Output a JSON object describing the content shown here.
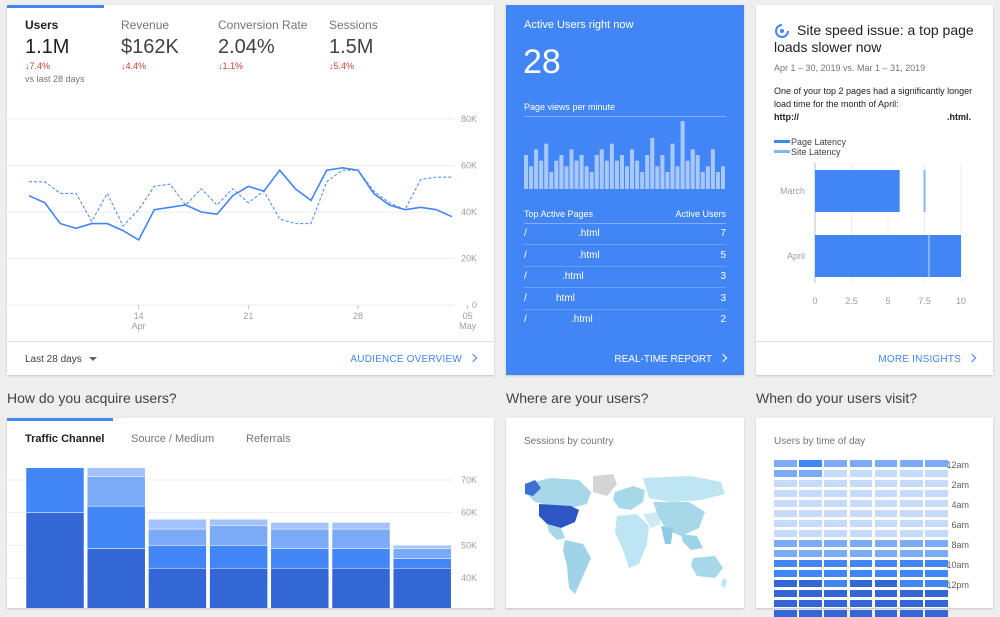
{
  "overview": {
    "tabs": [
      {
        "label": "Users",
        "value": "1.1M",
        "change": "↓7.4%",
        "active": true
      },
      {
        "label": "Revenue",
        "value": "$162K",
        "change": "↓4.4%",
        "active": false
      },
      {
        "label": "Conversion Rate",
        "value": "2.04%",
        "change": "↓1.1%",
        "active": false
      },
      {
        "label": "Sessions",
        "value": "1.5M",
        "change": "↓5.4%",
        "active": false
      }
    ],
    "compare_text": "vs last 28 days",
    "date_range": "Last 28 days",
    "footer_link": "AUDIENCE OVERVIEW"
  },
  "chart_data": {
    "type": "line",
    "y_ticks": [
      "80K",
      "60K",
      "40K",
      "20K",
      "0"
    ],
    "ylim": [
      0,
      80000
    ],
    "x_tick_labels": [
      {
        "day": "14",
        "month": "Apr",
        "index": 7
      },
      {
        "day": "21",
        "month": "",
        "index": 14
      },
      {
        "day": "28",
        "month": "",
        "index": 21
      },
      {
        "day": "05",
        "month": "May",
        "index": 28
      }
    ],
    "grid": true,
    "series": [
      {
        "values": [
          47000,
          44000,
          35000,
          33000,
          35000,
          35000,
          32000,
          28000,
          41000,
          42000,
          43000,
          40000,
          39000,
          47000,
          51000,
          49000,
          58000,
          50000,
          45000,
          58000,
          59000,
          58000,
          48000,
          43000,
          41000,
          42000,
          41000,
          38000
        ],
        "color": "#4285f4",
        "dashed": false
      },
      {
        "values": [
          53000,
          53000,
          48000,
          48000,
          36000,
          48000,
          34000,
          41000,
          51000,
          52000,
          43000,
          50000,
          43000,
          50000,
          44000,
          49000,
          37000,
          35000,
          35000,
          53000,
          58000,
          58000,
          49000,
          44000,
          41000,
          54000,
          55000,
          55000
        ],
        "color": "#4285f4",
        "dashed": true
      }
    ]
  },
  "realtime": {
    "title": "Active Users right now",
    "count": "28",
    "pageviews_label": "Page views per minute",
    "bars": [
      6,
      4,
      7,
      5,
      8,
      3,
      5,
      6,
      4,
      7,
      5,
      6,
      4,
      3,
      6,
      7,
      5,
      8,
      5,
      6,
      4,
      7,
      5,
      3,
      6,
      9,
      4,
      6,
      3,
      8,
      4,
      12,
      5,
      7,
      6,
      3,
      4,
      7,
      3,
      4
    ],
    "table_header_left": "Top Active Pages",
    "table_header_right": "Active Users",
    "rows": [
      {
        "page": "/",
        "ext": ".html",
        "users": "7"
      },
      {
        "page": "/",
        "ext": ".html",
        "users": "5"
      },
      {
        "page": "/",
        "ext": ".html",
        "users": "3"
      },
      {
        "page": "/",
        "ext": "html",
        "users": "3"
      },
      {
        "page": "/",
        "ext": ".html",
        "users": "2"
      }
    ],
    "footer_link": "REAL-TIME REPORT"
  },
  "insight": {
    "title": "Site speed issue: a top page loads slower now",
    "date_range": "Apr 1 – 30, 2019 vs. Mar 1 – 31, 2019",
    "body": "One of your top 2 pages had a significantly longer load time for the month of April:",
    "url_prefix": "http://",
    "url_suffix": ".html.",
    "legend_page_latency": "Page Latency",
    "legend_site_latency": "Site Latency",
    "categories": [
      "March",
      "April"
    ],
    "page_latency": [
      5.8,
      10
    ],
    "site_latency": [
      7.5,
      7.8
    ],
    "x_ticks": [
      "0",
      "2.5",
      "5",
      "7.5",
      "10"
    ],
    "xlim": [
      0,
      10
    ],
    "footer_link": "MORE INSIGHTS"
  },
  "acquisition": {
    "section_title": "How do you acquire users?",
    "tabs": [
      {
        "label": "Traffic Channel",
        "active": true
      },
      {
        "label": "Source / Medium",
        "active": false
      },
      {
        "label": "Referrals",
        "active": false
      }
    ],
    "y_ticks": [
      "70K",
      "60K",
      "50K",
      "40K"
    ],
    "bars": [
      [
        21000,
        12000,
        4000,
        3000,
        30000
      ],
      [
        13000,
        9000,
        3000,
        0,
        19000
      ],
      [
        7000,
        5000,
        3000,
        0,
        13000
      ],
      [
        7000,
        6000,
        2000,
        0,
        13000
      ],
      [
        6000,
        6000,
        2000,
        0,
        13000
      ],
      [
        6000,
        6000,
        2000,
        0,
        13000
      ],
      [
        3000,
        3000,
        1000,
        0,
        13000
      ]
    ],
    "segment_colors": [
      "#3367d6",
      "#4285f4",
      "#7baaf7",
      "#a1c2fa",
      "#c6dafc"
    ]
  },
  "geo": {
    "section_title": "Where are your users?",
    "card_title": "Sessions by country"
  },
  "time_of_day": {
    "section_title": "When do your users visit?",
    "card_title": "Users by time of day",
    "hour_labels": [
      "12am",
      "2am",
      "4am",
      "6am",
      "8am",
      "10am",
      "12pm"
    ],
    "rows": [
      [
        1,
        2,
        1,
        1,
        1,
        1,
        1
      ],
      [
        1,
        1,
        0,
        0,
        0,
        0,
        0
      ],
      [
        0,
        0,
        0,
        0,
        0,
        0,
        0
      ],
      [
        0,
        0,
        0,
        0,
        0,
        0,
        0
      ],
      [
        0,
        0,
        0,
        0,
        0,
        0,
        0
      ],
      [
        0,
        0,
        0,
        0,
        0,
        0,
        0
      ],
      [
        0,
        0,
        0,
        0,
        0,
        0,
        0
      ],
      [
        0,
        0,
        0,
        0,
        0,
        0,
        0
      ],
      [
        1,
        1,
        1,
        1,
        1,
        1,
        1
      ],
      [
        1,
        1,
        1,
        1,
        1,
        1,
        1
      ],
      [
        2,
        2,
        2,
        2,
        2,
        2,
        2
      ],
      [
        2,
        2,
        2,
        2,
        2,
        2,
        2
      ],
      [
        3,
        3,
        2,
        3,
        3,
        2,
        2
      ],
      [
        3,
        3,
        3,
        3,
        3,
        3,
        3
      ],
      [
        3,
        3,
        3,
        3,
        3,
        3,
        3
      ],
      [
        3,
        3,
        3,
        3,
        3,
        3,
        3
      ]
    ],
    "colors": [
      "#c6dafc",
      "#7baaf7",
      "#4285f4",
      "#3367d6"
    ]
  }
}
